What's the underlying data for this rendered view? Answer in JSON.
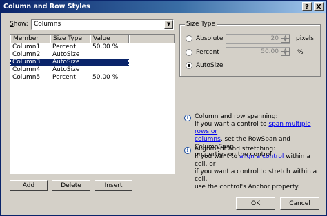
{
  "window": {
    "title": "Column and Row Styles",
    "help_glyph": "?",
    "close_glyph": "X"
  },
  "show": {
    "label_prefix": "",
    "label_key": "S",
    "label_rest": "how:",
    "value": "Columns",
    "dropdown_glyph": "▼"
  },
  "table": {
    "headers": [
      "Member",
      "Size Type",
      "Value"
    ],
    "rows": [
      {
        "member": "Column1",
        "size_type": "Percent",
        "value": "50.00 %",
        "selected": false
      },
      {
        "member": "Column2",
        "size_type": "AutoSize",
        "value": "",
        "selected": false
      },
      {
        "member": "Column3",
        "size_type": "AutoSize",
        "value": "",
        "selected": true
      },
      {
        "member": "Column4",
        "size_type": "AutoSize",
        "value": "",
        "selected": false
      },
      {
        "member": "Column5",
        "size_type": "Percent",
        "value": "50.00 %",
        "selected": false
      }
    ]
  },
  "buttons": {
    "add_key": "A",
    "add_rest": "dd",
    "delete_key": "D",
    "delete_rest": "elete",
    "insert_key": "I",
    "insert_rest": "nsert",
    "ok": "OK",
    "cancel": "Cancel"
  },
  "size_type": {
    "group_label": "Size Type",
    "absolute": {
      "key": "A",
      "rest": "bsolute",
      "value": "20",
      "unit": "pixels",
      "selected": false
    },
    "percent": {
      "key": "P",
      "rest": "ercent",
      "value": "50.00",
      "unit": "%",
      "selected": false
    },
    "autosize": {
      "pre": "A",
      "key": "u",
      "rest": "toSize",
      "selected": true
    }
  },
  "info1": {
    "line1": "Column and row spanning:",
    "line2_pre": "If you want a control to ",
    "link1": "span multiple rows or",
    "link2": "columns",
    "line3_rest": ", set the RowSpan and ColumnSpan",
    "line4": "properties on the control."
  },
  "info2": {
    "line1": "Alignment and stretching:",
    "line2_pre": "If you want to ",
    "link": "align a control",
    "line2_post": " within a cell, or",
    "line3": "if you want a control to stretch within a cell,",
    "line4": "use the control's Anchor property."
  }
}
